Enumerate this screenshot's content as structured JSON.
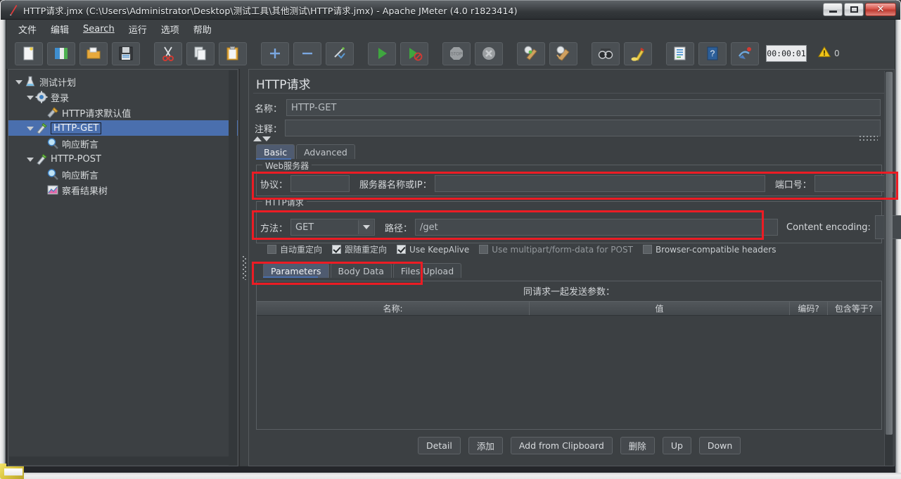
{
  "window": {
    "title": "HTTP请求.jmx (C:\\Users\\Administrator\\Desktop\\测试工具\\其他测试\\HTTP请求.jmx) - Apache JMeter (4.0 r1823414)",
    "app_icon": "jmeter-feather-icon",
    "controls": {
      "minimize": "minimize-button",
      "maximize": "maximize-button",
      "close": "✕"
    }
  },
  "menubar": {
    "items": [
      {
        "label": "文件",
        "mnemonic": ""
      },
      {
        "label": "编辑",
        "mnemonic": ""
      },
      {
        "label": "Search",
        "mnemonic": "S"
      },
      {
        "label": "运行",
        "mnemonic": ""
      },
      {
        "label": "选项",
        "mnemonic": ""
      },
      {
        "label": "帮助",
        "mnemonic": ""
      }
    ]
  },
  "toolbar": {
    "buttons": [
      {
        "name": "new-icon"
      },
      {
        "name": "templates-icon"
      },
      {
        "name": "open-icon"
      },
      {
        "name": "save-icon"
      },
      {
        "name": "cut-icon"
      },
      {
        "name": "copy-icon"
      },
      {
        "name": "paste-icon"
      },
      {
        "name": "expand-all-icon"
      },
      {
        "name": "collapse-all-icon"
      },
      {
        "name": "toggle-icon"
      },
      {
        "name": "start-icon"
      },
      {
        "name": "start-no-pauses-icon"
      },
      {
        "name": "stop-icon"
      },
      {
        "name": "shutdown-icon"
      },
      {
        "name": "clear-icon"
      },
      {
        "name": "clear-all-icon"
      },
      {
        "name": "search-icon"
      },
      {
        "name": "search-reset-icon"
      },
      {
        "name": "function-helper-icon"
      },
      {
        "name": "help-icon"
      },
      {
        "name": "undo-redo-icon"
      }
    ],
    "timer": "00:00:01",
    "warning_icon": "warning-triangle-icon",
    "warning_count": "0"
  },
  "tree": {
    "nodes": [
      {
        "label": "测试计划",
        "icon": "test-plan-icon",
        "indent": 0,
        "toggle": "open",
        "selected": false,
        "boxed": false
      },
      {
        "label": "登录",
        "icon": "thread-group-icon",
        "indent": 1,
        "toggle": "open",
        "selected": false,
        "boxed": false
      },
      {
        "label": "HTTP请求默认值",
        "icon": "http-defaults-icon",
        "indent": 2,
        "toggle": "none",
        "selected": false,
        "boxed": false
      },
      {
        "label": "HTTP-GET",
        "icon": "http-sampler-icon",
        "indent": 2,
        "toggle": "open",
        "selected": true,
        "boxed": true
      },
      {
        "label": "响应断言",
        "icon": "assertion-icon",
        "indent": 3,
        "toggle": "none",
        "selected": false,
        "boxed": false
      },
      {
        "label": "HTTP-POST",
        "icon": "http-sampler-icon",
        "indent": 2,
        "toggle": "open",
        "selected": false,
        "boxed": false
      },
      {
        "label": "响应断言",
        "icon": "assertion-icon",
        "indent": 3,
        "toggle": "none",
        "selected": false,
        "boxed": false
      },
      {
        "label": "察看结果树",
        "icon": "view-results-tree-icon",
        "indent": 2,
        "toggle": "none",
        "selected": false,
        "boxed": false
      }
    ]
  },
  "panel": {
    "title": "HTTP请求",
    "name_label": "名称：",
    "name_value": "HTTP-GET",
    "comment_label": "注释：",
    "comment_value": "",
    "tabs": [
      {
        "label": "Basic",
        "active": true
      },
      {
        "label": "Advanced",
        "active": false
      }
    ],
    "web_server": {
      "group_title": "Web服务器",
      "protocol_label": "协议：",
      "protocol_value": "",
      "server_label": "服务器名称或IP：",
      "server_value": "",
      "port_label": "端口号：",
      "port_value": ""
    },
    "http_request": {
      "group_title": "HTTP请求",
      "method_label": "方法：",
      "method_value": "GET",
      "path_label": "路径：",
      "path_value": "/get",
      "content_encoding_label": "Content encoding:",
      "content_encoding_value": ""
    },
    "options": [
      {
        "label": "自动重定向",
        "checked": false,
        "dim": false
      },
      {
        "label": "跟随重定向",
        "checked": true,
        "dim": false
      },
      {
        "label": "Use KeepAlive",
        "checked": true,
        "dim": false
      },
      {
        "label": "Use multipart/form-data for POST",
        "checked": false,
        "dim": true
      },
      {
        "label": "Browser-compatible headers",
        "checked": false,
        "dim": false
      }
    ],
    "param_tabs": [
      {
        "label": "Parameters",
        "active": true
      },
      {
        "label": "Body Data",
        "active": false
      },
      {
        "label": "Files Upload",
        "active": false
      }
    ],
    "params_table": {
      "caption": "同请求一起发送参数：",
      "columns": [
        "名称:",
        "值",
        "编码?",
        "包含等于?"
      ],
      "rows": []
    },
    "action_buttons": [
      {
        "label": "Detail"
      },
      {
        "label": "添加"
      },
      {
        "label": "Add from Clipboard"
      },
      {
        "label": "删除"
      },
      {
        "label": "Up"
      },
      {
        "label": "Down"
      }
    ]
  },
  "colors": {
    "accent_selection": "#4a6fae",
    "annotation_red": "#ec1c24",
    "panel_bg": "#3c4043",
    "window_bg": "#2f3133"
  }
}
